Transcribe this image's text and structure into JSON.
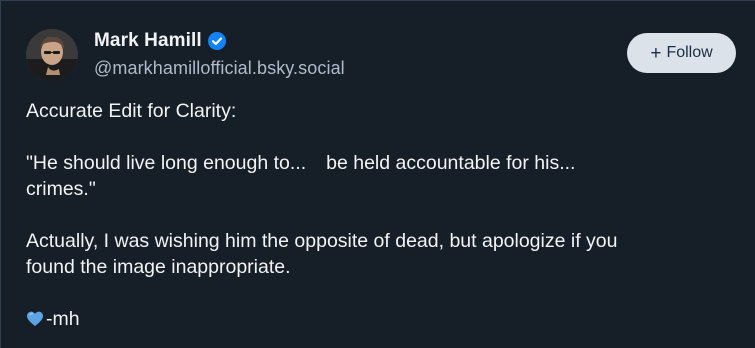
{
  "author": {
    "display_name": "Mark Hamill",
    "handle": "@markhamillofficial.bsky.social",
    "verified": true,
    "avatar_icon": "avatar-photo"
  },
  "follow_button": {
    "icon": "plus-icon",
    "label": "Follow"
  },
  "post": {
    "line1": "Accurate Edit for Clarity:",
    "line2a": "\"He should live long enough to...",
    "line2b": "be held accountable for his...",
    "line3": "crimes.\"",
    "line4": "Actually, I was wishing him the opposite of dead, but apologize if you",
    "line5": "found the image inappropriate.",
    "signoff_icon": "blue-heart-icon",
    "signoff": "-mh"
  },
  "colors": {
    "background": "#161e27",
    "verified_blue": "#1083fe",
    "heart_blue": "#5ba4e5",
    "button_bg": "#dce2ea"
  }
}
